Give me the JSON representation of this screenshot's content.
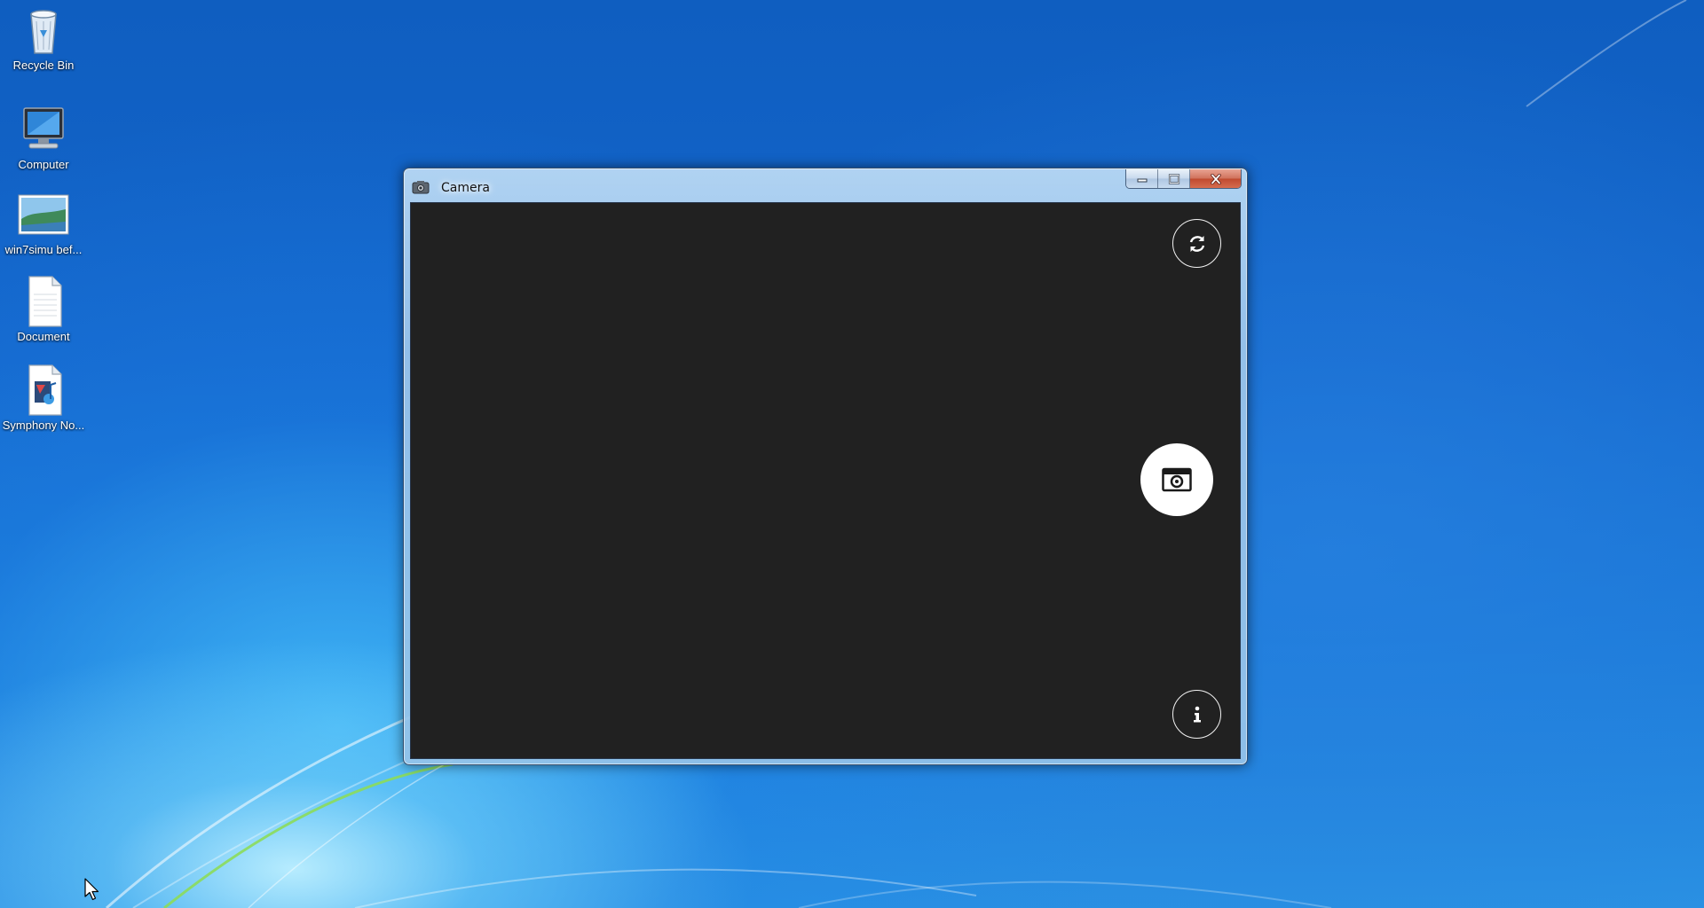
{
  "desktop": {
    "icons": [
      {
        "name": "recycle-bin",
        "label": "Recycle Bin",
        "icon": "recycle-bin-icon"
      },
      {
        "name": "computer",
        "label": "Computer",
        "icon": "computer-icon"
      },
      {
        "name": "win7simu",
        "label": "win7simu bef...",
        "icon": "image-file-icon"
      },
      {
        "name": "document",
        "label": "Document",
        "icon": "text-document-icon"
      },
      {
        "name": "symphony",
        "label": "Symphony No...",
        "icon": "media-file-icon"
      }
    ]
  },
  "window": {
    "title": "Camera",
    "title_icon": "camera-app-icon",
    "caption_buttons": [
      "minimize",
      "maximize",
      "close"
    ]
  },
  "camera": {
    "viewfinder_color": "#212121",
    "switch_camera_icon": "switch-camera-icon",
    "capture_icon": "camera-shutter-icon",
    "info_icon": "info-icon"
  },
  "colors": {
    "close_button": "#c7503a",
    "desktop_blue": "#1466cc"
  }
}
